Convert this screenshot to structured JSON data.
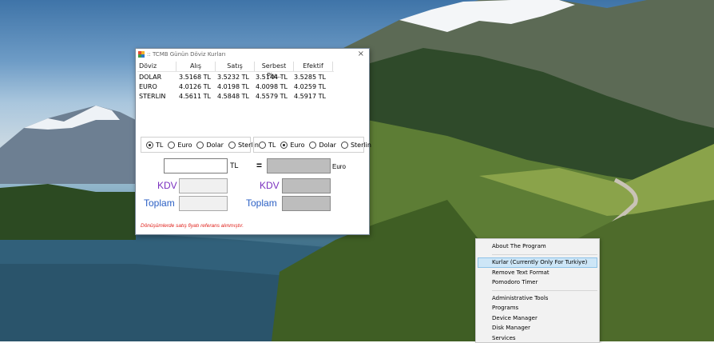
{
  "window": {
    "title": ":: TCMB Günün Döviz Kurları",
    "close_glyph": "×",
    "table": {
      "headers": [
        "Döviz",
        "Alış",
        "Satış",
        "Serbest Piy...",
        "Efektif"
      ],
      "rows": [
        [
          "DOLAR",
          "3.5168 TL",
          "3.5232 TL",
          "3.5144 TL",
          "3.5285 TL"
        ],
        [
          "EURO",
          "4.0126 TL",
          "4.0198 TL",
          "4.0098 TL",
          "4.0259 TL"
        ],
        [
          "STERLIN",
          "4.5611 TL",
          "4.5848 TL",
          "4.5579 TL",
          "4.5917 TL"
        ]
      ]
    },
    "from_options": [
      {
        "label": "TL",
        "selected": true
      },
      {
        "label": "Euro",
        "selected": false
      },
      {
        "label": "Dolar",
        "selected": false
      },
      {
        "label": "Sterlin",
        "selected": false
      }
    ],
    "to_options": [
      {
        "label": "TL",
        "selected": false
      },
      {
        "label": "Euro",
        "selected": true
      },
      {
        "label": "Dolar",
        "selected": false
      },
      {
        "label": "Sterlin",
        "selected": false
      }
    ],
    "from_unit": "TL",
    "equals": "=",
    "to_unit": "Euro",
    "kdv_label": "KDV",
    "toplam_label": "Toplam",
    "note": "Dönüşümlerde satış fiyatı referans alınmıştır.",
    "colors": {
      "kdv": "#7a2fbf",
      "toplam": "#2a5fc4",
      "note": "#e0201a"
    }
  },
  "context_menu": {
    "items": [
      "About The Program",
      "Kurlar (Currently Only For Turkiye)",
      "Remove Text Format",
      "Pomodoro Timer",
      "Administrative Tools",
      "Programs",
      "Device Manager",
      "Disk Manager",
      "Services"
    ],
    "highlighted_index": 1
  }
}
